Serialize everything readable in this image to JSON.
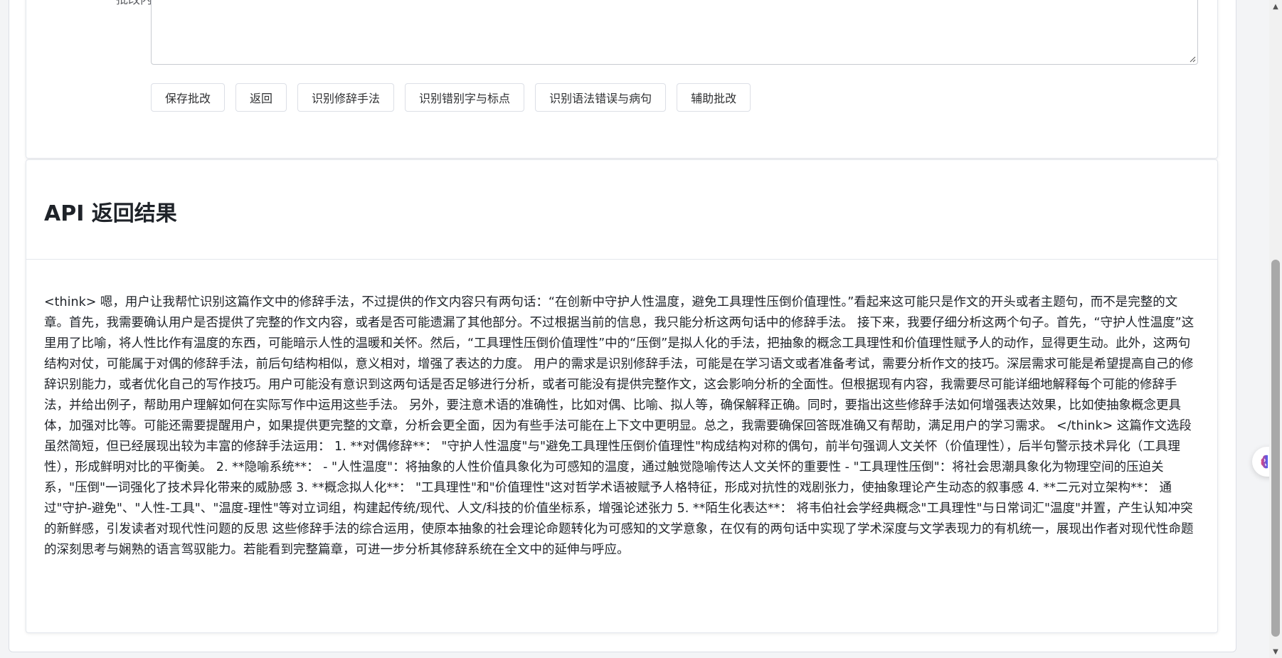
{
  "form": {
    "label": "批改内容",
    "textarea_value": ""
  },
  "buttons": {
    "save": "保存批改",
    "back": "返回",
    "rhetoric": "识别修辞手法",
    "typos": "识别错别字与标点",
    "grammar": "识别语法错误与病句",
    "assist": "辅助批改"
  },
  "api": {
    "title": "API 返回结果",
    "result": "<think> 嗯，用户让我帮忙识别这篇作文中的修辞手法，不过提供的作文内容只有两句话：“在创新中守护人性温度，避免工具理性压倒价值理性。”看起来这可能只是作文的开头或者主题句，而不是完整的文章。首先，我需要确认用户是否提供了完整的作文内容，或者是否可能遗漏了其他部分。不过根据当前的信息，我只能分析这两句话中的修辞手法。 接下来，我要仔细分析这两个句子。首先，“守护人性温度”这里用了比喻，将人性比作有温度的东西，可能暗示人性的温暖和关怀。然后，“工具理性压倒价值理性”中的“压倒”是拟人化的手法，把抽象的概念工具理性和价值理性赋予人的动作，显得更生动。此外，这两句结构对仗，可能属于对偶的修辞手法，前后句结构相似，意义相对，增强了表达的力度。 用户的需求是识别修辞手法，可能是在学习语文或者准备考试，需要分析作文的技巧。深层需求可能是希望提高自己的修辞识别能力，或者优化自己的写作技巧。用户可能没有意识到这两句话是否足够进行分析，或者可能没有提供完整作文，这会影响分析的全面性。但根据现有内容，我需要尽可能详细地解释每个可能的修辞手法，并给出例子，帮助用户理解如何在实际写作中运用这些手法。 另外，要注意术语的准确性，比如对偶、比喻、拟人等，确保解释正确。同时，要指出这些修辞手法如何增强表达效果，比如使抽象概念更具体，加强对比等。可能还需要提醒用户，如果提供更完整的文章，分析会更全面，因为有些手法可能在上下文中更明显。总之，我需要确保回答既准确又有帮助，满足用户的学习需求。 </think> 这篇作文选段虽然简短，但已经展现出较为丰富的修辞手法运用： 1. **对偶修辞**： \"守护人性温度\"与\"避免工具理性压倒价值理性\"构成结构对称的偶句，前半句强调人文关怀（价值理性），后半句警示技术异化（工具理性），形成鲜明对比的平衡美。 2. **隐喻系统**： - \"人性温度\"：将抽象的人性价值具象化为可感知的温度，通过触觉隐喻传达人文关怀的重要性 - \"工具理性压倒\"：将社会思潮具象化为物理空间的压迫关系，\"压倒\"一词强化了技术异化带来的威胁感 3. **概念拟人化**： \"工具理性\"和\"价值理性\"这对哲学术语被赋予人格特征，形成对抗性的戏剧张力，使抽象理论产生动态的叙事感 4. **二元对立架构**： 通过\"守护-避免\"、\"人性-工具\"、\"温度-理性\"等对立词组，构建起传统/现代、人文/科技的价值坐标系，增强论述张力 5. **陌生化表达**： 将韦伯社会学经典概念\"工具理性\"与日常词汇\"温度\"并置，产生认知冲突的新鲜感，引发读者对现代性问题的反思 这些修辞手法的综合运用，使原本抽象的社会理论命题转化为可感知的文学意象，在仅有的两句话中实现了学术深度与文学表现力的有机统一，展现出作者对现代性命题的深刻思考与娴熟的语言驾驭能力。若能看到完整篇章，可进一步分析其修辞系统在全文中的延伸与呼应。"
  },
  "icons": {
    "float_widget": "brain-icon",
    "scroll_up": "chevron-up-icon",
    "scroll_down": "chevron-down-icon"
  },
  "colors": {
    "float_widget_gradient_start": "#e0457b",
    "float_widget_gradient_end": "#4a5cf5"
  }
}
